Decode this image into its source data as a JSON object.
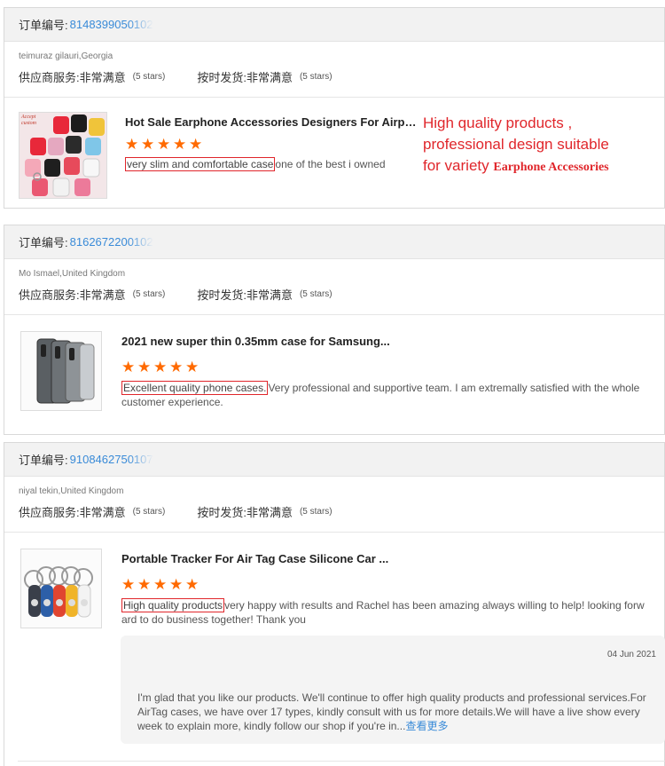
{
  "labels": {
    "order_prefix": "订单编号:",
    "supplier_service": "供应商服务:",
    "on_time": "按时发货:",
    "very_satisfied": "非常满意",
    "five_stars": "(5 stars)"
  },
  "orders": [
    {
      "order_no": "8148399050102",
      "buyer": "teimuraz gilauri,Georgia",
      "product_title": "Hot Sale Earphone Accessories Designers For Airpods...",
      "highlight": "very slim and comfortable case",
      "review_rest": "one of the best i owned",
      "thumb_text": "Accept custom"
    },
    {
      "order_no": "8162672200102",
      "buyer": "Mo Ismael,United Kingdom",
      "product_title": "2021 new super thin 0.35mm case for Samsung...",
      "highlight": "Excellent quality phone cases.",
      "review_rest": "Very professional and supportive team. I am extremally satisfied with the whole customer experience."
    },
    {
      "order_no": "9108462750107",
      "buyer": "niyal tekin,United Kingdom",
      "product_title": "Portable Tracker For Air Tag Case Silicone Car ...",
      "highlight": "High quality products",
      "review_rest": "very happy with results and Rachel has been amazing always willing to help! looking forward to do business together! Thank you"
    }
  ],
  "promo": {
    "line1": "High quality products ,",
    "line2": "professional design suitable",
    "line3a": "for variety ",
    "line3b": "Earphone Accessories"
  },
  "reply": {
    "date": "04 Jun 2021",
    "text": "I'm glad that you like our products. We'll continue to offer high quality products and professional services.For AirTag cases, we have over 17 types, kindly consult with us for more details.We will have a live show every week to explain more, kindly follow our shop if you're in...",
    "more": "查看更多"
  },
  "colors": {
    "accent": "#3a8bd8",
    "star": "#ff6a00",
    "highlight_border": "#e0262b"
  }
}
